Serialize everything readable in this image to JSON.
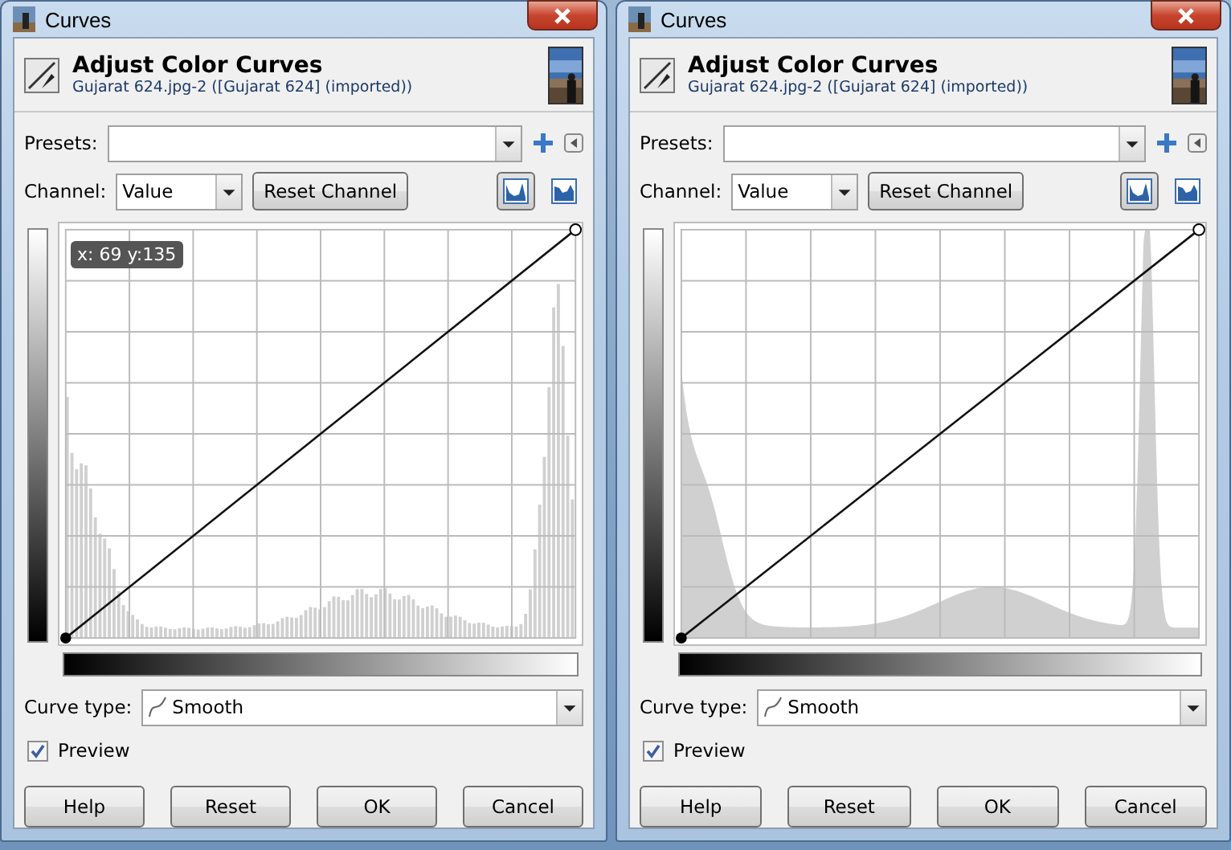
{
  "dialogs": [
    {
      "title": "Curves",
      "heading": "Adjust Color Curves",
      "subtitle": "Gujarat 624.jpg-2 ([Gujarat 624] (imported))",
      "presets_label": "Presets:",
      "channel": {
        "label": "Channel:",
        "value": "Value"
      },
      "reset_channel": "Reset Channel",
      "view_modes": [
        {
          "selected": true
        },
        {
          "selected": false
        }
      ],
      "tooltip": "x: 69 y:135",
      "histogram": {
        "kind": "bars"
      },
      "curve_type": {
        "label": "Curve type:",
        "value": "Smooth"
      },
      "preview": {
        "label": "Preview",
        "checked": true
      },
      "buttons": [
        "Help",
        "Reset",
        "OK",
        "Cancel"
      ]
    },
    {
      "title": "Curves",
      "heading": "Adjust Color Curves",
      "subtitle": "Gujarat 624.jpg-2 ([Gujarat 624] (imported))",
      "presets_label": "Presets:",
      "channel": {
        "label": "Channel:",
        "value": "Value"
      },
      "reset_channel": "Reset Channel",
      "view_modes": [
        {
          "selected": true
        },
        {
          "selected": false
        }
      ],
      "histogram": {
        "kind": "smooth"
      },
      "curve_type": {
        "label": "Curve type:",
        "value": "Smooth"
      },
      "preview": {
        "label": "Preview",
        "checked": true
      },
      "buttons": [
        "Help",
        "Reset",
        "OK",
        "Cancel"
      ]
    }
  ]
}
